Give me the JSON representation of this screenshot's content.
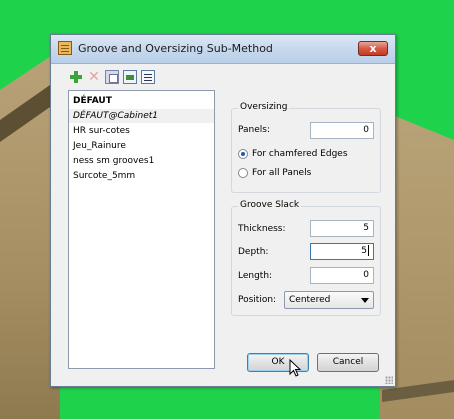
{
  "window": {
    "title": "Groove and Oversizing Sub-Method",
    "close_label": "x"
  },
  "toolbar": {
    "icons": [
      "add-icon",
      "delete-icon",
      "copy-icon",
      "properties-icon",
      "list-icon"
    ]
  },
  "methods_list": {
    "items": [
      {
        "label": "DÉFAUT",
        "style": "bold"
      },
      {
        "label": "DÉFAUT@Cabinet1",
        "style": "selected-italic"
      },
      {
        "label": "HR sur-cotes",
        "style": "normal"
      },
      {
        "label": "Jeu_Rainure",
        "style": "normal"
      },
      {
        "label": "ness sm grooves1",
        "style": "normal"
      },
      {
        "label": "Surcote_5mm",
        "style": "normal"
      }
    ]
  },
  "oversizing": {
    "group_label": "Oversizing",
    "panels_label": "Panels:",
    "panels_value": "0",
    "radio_chamfered_label": "For chamfered Edges",
    "radio_chamfered_checked": true,
    "radio_all_label": "For all Panels",
    "radio_all_checked": false
  },
  "groove_slack": {
    "group_label": "Groove Slack",
    "thickness_label": "Thickness:",
    "thickness_value": "5",
    "depth_label": "Depth:",
    "depth_value": "5",
    "length_label": "Length:",
    "length_value": "0",
    "position_label": "Position:",
    "position_value": "Centered"
  },
  "buttons": {
    "ok_label": "OK",
    "cancel_label": "Cancel"
  },
  "colors": {
    "background_green": "#1fd24b",
    "title_bar": "#c7d9ee",
    "close_button": "#d45b45",
    "selection_radio": "#1f5aa8"
  }
}
